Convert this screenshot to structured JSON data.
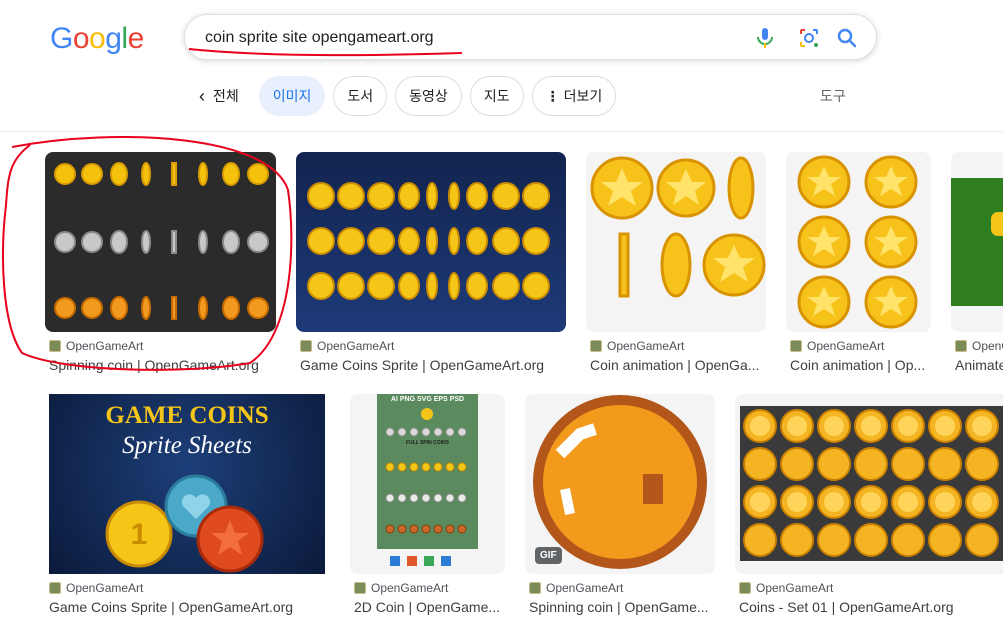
{
  "search": {
    "query": "coin sprite site opengameart.org"
  },
  "tabs": {
    "back": "전체",
    "items": [
      "이미지",
      "도서",
      "동영상",
      "지도",
      "더보기"
    ],
    "tools": "도구"
  },
  "results": [
    {
      "source": "OpenGameArt",
      "title": "Spinning coin | OpenGameArt.org"
    },
    {
      "source": "OpenGameArt",
      "title": "Game Coins Sprite | OpenGameArt.org"
    },
    {
      "source": "OpenGameArt",
      "title": "Coin animation | OpenGa..."
    },
    {
      "source": "OpenGameArt",
      "title": "Coin animation | Op..."
    },
    {
      "source": "OpenG",
      "title": "Animate"
    },
    {
      "source": "OpenGameArt",
      "title": "Game Coins Sprite | OpenGameArt.org",
      "image_text": [
        "GAME COINS",
        "Sprite Sheets"
      ]
    },
    {
      "source": "OpenGameArt",
      "title": "2D Coin | OpenGame...",
      "image_text": [
        "AI PNG SVG EPS PSD",
        "FULL SPIN COINS"
      ]
    },
    {
      "source": "OpenGameArt",
      "title": "Spinning coin | OpenGame...",
      "badge": "GIF"
    },
    {
      "source": "OpenGameArt",
      "title": "Coins - Set 01 | OpenGameArt.org"
    }
  ],
  "colors": {
    "accent": "#1a73e8",
    "annotation": "#e8001c",
    "coin_gold": "#f5c518"
  }
}
